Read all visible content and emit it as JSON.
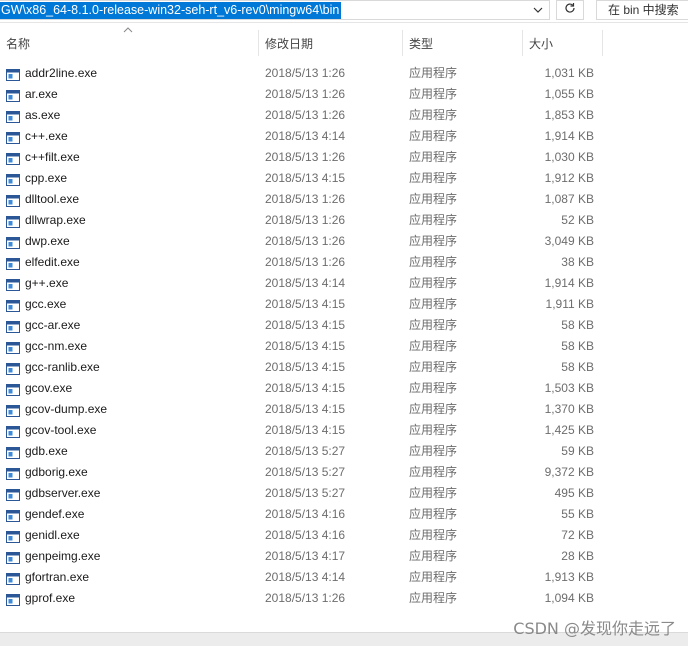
{
  "address_bar": {
    "path": "GW\\x86_64-8.1.0-release-win32-seh-rt_v6-rev0\\mingw64\\bin",
    "dropdown_icon": "chevron-down-icon",
    "refresh_icon": "refresh-icon"
  },
  "search": {
    "placeholder": "在 bin 中搜索"
  },
  "columns": {
    "name": "名称",
    "date": "修改日期",
    "type": "类型",
    "size": "大小"
  },
  "files": [
    {
      "name": "addr2line.exe",
      "date": "2018/5/13 1:26",
      "type": "应用程序",
      "size": "1,031 KB"
    },
    {
      "name": "ar.exe",
      "date": "2018/5/13 1:26",
      "type": "应用程序",
      "size": "1,055 KB"
    },
    {
      "name": "as.exe",
      "date": "2018/5/13 1:26",
      "type": "应用程序",
      "size": "1,853 KB"
    },
    {
      "name": "c++.exe",
      "date": "2018/5/13 4:14",
      "type": "应用程序",
      "size": "1,914 KB"
    },
    {
      "name": "c++filt.exe",
      "date": "2018/5/13 1:26",
      "type": "应用程序",
      "size": "1,030 KB"
    },
    {
      "name": "cpp.exe",
      "date": "2018/5/13 4:15",
      "type": "应用程序",
      "size": "1,912 KB"
    },
    {
      "name": "dlltool.exe",
      "date": "2018/5/13 1:26",
      "type": "应用程序",
      "size": "1,087 KB"
    },
    {
      "name": "dllwrap.exe",
      "date": "2018/5/13 1:26",
      "type": "应用程序",
      "size": "52 KB"
    },
    {
      "name": "dwp.exe",
      "date": "2018/5/13 1:26",
      "type": "应用程序",
      "size": "3,049 KB"
    },
    {
      "name": "elfedit.exe",
      "date": "2018/5/13 1:26",
      "type": "应用程序",
      "size": "38 KB"
    },
    {
      "name": "g++.exe",
      "date": "2018/5/13 4:14",
      "type": "应用程序",
      "size": "1,914 KB"
    },
    {
      "name": "gcc.exe",
      "date": "2018/5/13 4:15",
      "type": "应用程序",
      "size": "1,911 KB"
    },
    {
      "name": "gcc-ar.exe",
      "date": "2018/5/13 4:15",
      "type": "应用程序",
      "size": "58 KB"
    },
    {
      "name": "gcc-nm.exe",
      "date": "2018/5/13 4:15",
      "type": "应用程序",
      "size": "58 KB"
    },
    {
      "name": "gcc-ranlib.exe",
      "date": "2018/5/13 4:15",
      "type": "应用程序",
      "size": "58 KB"
    },
    {
      "name": "gcov.exe",
      "date": "2018/5/13 4:15",
      "type": "应用程序",
      "size": "1,503 KB"
    },
    {
      "name": "gcov-dump.exe",
      "date": "2018/5/13 4:15",
      "type": "应用程序",
      "size": "1,370 KB"
    },
    {
      "name": "gcov-tool.exe",
      "date": "2018/5/13 4:15",
      "type": "应用程序",
      "size": "1,425 KB"
    },
    {
      "name": "gdb.exe",
      "date": "2018/5/13 5:27",
      "type": "应用程序",
      "size": "59 KB"
    },
    {
      "name": "gdborig.exe",
      "date": "2018/5/13 5:27",
      "type": "应用程序",
      "size": "9,372 KB"
    },
    {
      "name": "gdbserver.exe",
      "date": "2018/5/13 5:27",
      "type": "应用程序",
      "size": "495 KB"
    },
    {
      "name": "gendef.exe",
      "date": "2018/5/13 4:16",
      "type": "应用程序",
      "size": "55 KB"
    },
    {
      "name": "genidl.exe",
      "date": "2018/5/13 4:16",
      "type": "应用程序",
      "size": "72 KB"
    },
    {
      "name": "genpeimg.exe",
      "date": "2018/5/13 4:17",
      "type": "应用程序",
      "size": "28 KB"
    },
    {
      "name": "gfortran.exe",
      "date": "2018/5/13 4:14",
      "type": "应用程序",
      "size": "1,913 KB"
    },
    {
      "name": "gprof.exe",
      "date": "2018/5/13 1:26",
      "type": "应用程序",
      "size": "1,094 KB"
    }
  ],
  "file_icon": "application-exe-icon",
  "watermark": "CSDN @发现你走远了",
  "colors": {
    "selection": "#0078d7",
    "icon_frame": "#2b5797",
    "secondary_text": "#6d6d6d"
  }
}
